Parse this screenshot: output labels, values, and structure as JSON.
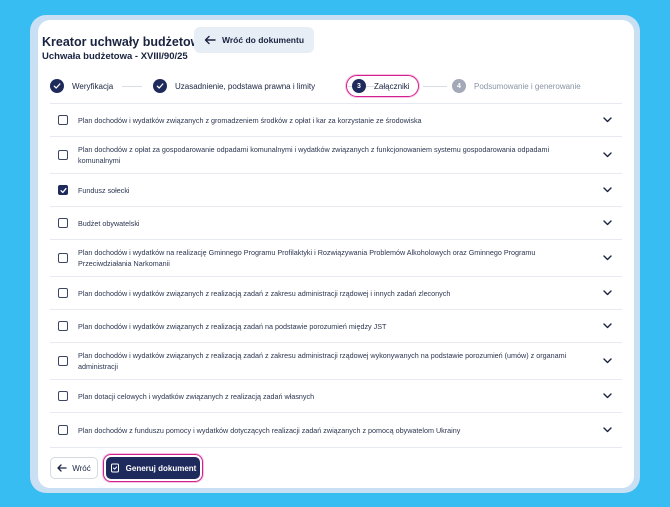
{
  "header": {
    "title": "Kreator uchwały budżetowej",
    "back_to_document": "Wróć do dokumentu",
    "subtitle": "Uchwała budżetowa - XVIII/90/25"
  },
  "steps": [
    {
      "label": "Weryfikacja",
      "state": "done"
    },
    {
      "label": "Uzasadnienie, podstawa prawna i limity",
      "state": "done"
    },
    {
      "number": "3",
      "label": "Załączniki",
      "state": "current"
    },
    {
      "number": "4",
      "label": "Podsumowanie i generowanie",
      "state": "pending"
    }
  ],
  "attachments": [
    {
      "label": "Plan dochodów i wydatków związanych z gromadzeniem środków z opłat i kar za korzystanie ze środowiska",
      "checked": false
    },
    {
      "label": "Plan dochodów z opłat za gospodarowanie odpadami komunalnymi i wydatków związanych z funkcjonowaniem systemu gospodarowania odpadami komunalnymi",
      "checked": false
    },
    {
      "label": "Fundusz sołecki",
      "checked": true
    },
    {
      "label": "Budżet obywatelski",
      "checked": false
    },
    {
      "label": "Plan dochodów i wydatków na realizację Gminnego Programu Profilaktyki i Rozwiązywania Problemów Alkoholowych oraz Gminnego Programu Przeciwdziałania Narkomanii",
      "checked": false
    },
    {
      "label": "Plan dochodów i wydatków związanych z realizacją zadań z zakresu administracji rządowej i innych zadań zleconych",
      "checked": false
    },
    {
      "label": "Plan dochodów i wydatków związanych z realizacją zadań na podstawie porozumień między JST",
      "checked": false
    },
    {
      "label": "Plan dochodów i wydatków związanych z realizacją zadań z zakresu administracji rządowej wykonywanych na podstawie porozumień (umów) z organami administracji",
      "checked": false
    },
    {
      "label": "Plan dotacji celowych i wydatków związanych z realizacją zadań własnych",
      "checked": false
    },
    {
      "label": "Plan dochodów z funduszu pomocy i wydatków dotyczących realizacji zadań związanych z pomocą obywatelom Ukrainy",
      "checked": false
    }
  ],
  "footer": {
    "back_label": "Wróć",
    "generate_label": "Generuj dokument"
  },
  "colors": {
    "background": "#38bdf2",
    "primary": "#1f2a5c",
    "highlight": "#d21f8f"
  }
}
